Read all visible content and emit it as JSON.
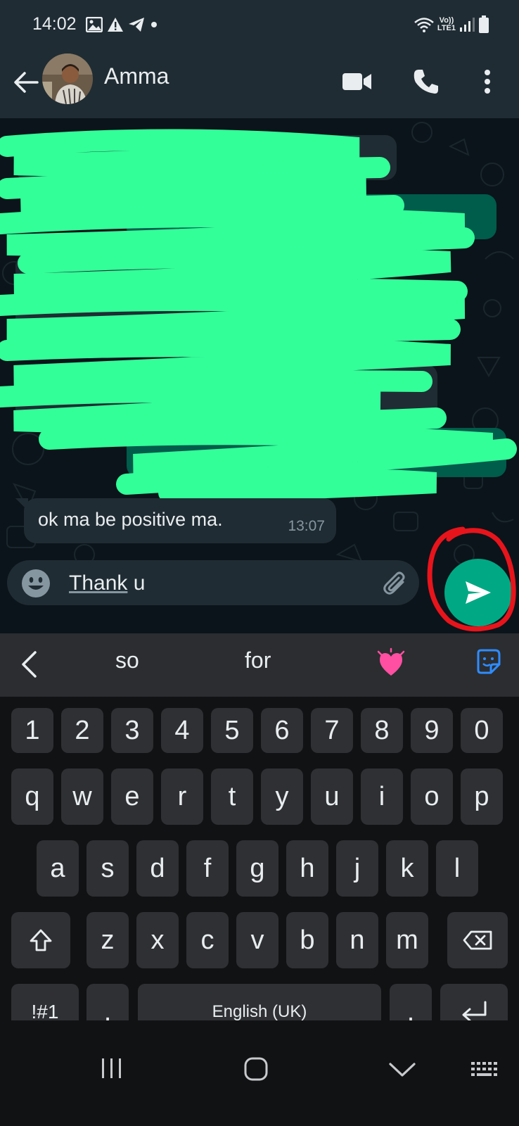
{
  "status_bar": {
    "time": "14:02",
    "network_label_top": "Vo))",
    "network_label_bottom": "LTE1"
  },
  "header": {
    "contact_name": "Amma"
  },
  "chat": {
    "last_message": {
      "text": "ok ma be positive ma.",
      "time": "13:07"
    }
  },
  "compose": {
    "typed_word_underlined": "Thank",
    "typed_rest": " u"
  },
  "keyboard": {
    "suggestions": [
      "so",
      "for"
    ],
    "suggestion_emoji": "💗",
    "number_row": [
      "1",
      "2",
      "3",
      "4",
      "5",
      "6",
      "7",
      "8",
      "9",
      "0"
    ],
    "row1": [
      "q",
      "w",
      "e",
      "r",
      "t",
      "y",
      "u",
      "i",
      "o",
      "p"
    ],
    "row2": [
      "a",
      "s",
      "d",
      "f",
      "g",
      "h",
      "j",
      "k",
      "l"
    ],
    "row3": [
      "z",
      "x",
      "c",
      "v",
      "b",
      "n",
      "m"
    ],
    "symbols_key": "!#1",
    "comma_key": ",",
    "space_key": "English (UK)",
    "period_key": "."
  },
  "colors": {
    "accent_send": "#00a884",
    "annotation": "#e8141c",
    "redaction": "#33ff99"
  }
}
